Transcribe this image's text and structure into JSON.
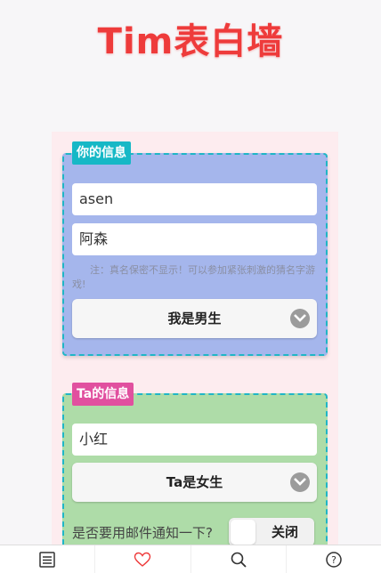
{
  "header": {
    "title": "Tim表白墙"
  },
  "your_info": {
    "badge": "你的信息",
    "name_value": "asen",
    "real_name_value": "阿森",
    "note": "注：真名保密不显示！可以参加紧张刺激的猜名字游戏!",
    "gender_select": "我是男生"
  },
  "ta_info": {
    "badge": "Ta的信息",
    "name_value": "小红",
    "gender_select": "Ta是女生",
    "notify_label": "是否要用邮件通知一下?",
    "notify_toggle": "关闭"
  },
  "tabbar": {
    "items": [
      {
        "icon": "list-icon"
      },
      {
        "icon": "heart-icon",
        "active_color": "#ee3b3b"
      },
      {
        "icon": "search-icon"
      },
      {
        "icon": "help-icon"
      }
    ]
  }
}
